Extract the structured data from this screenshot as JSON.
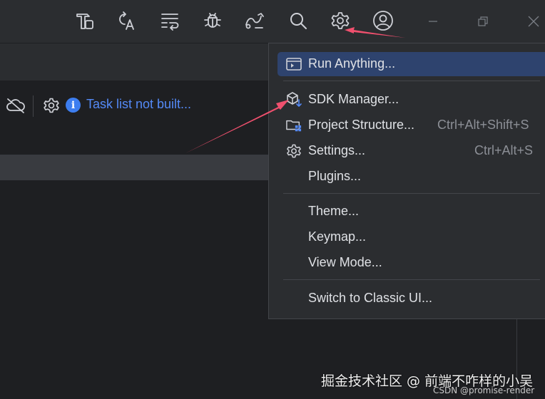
{
  "toolbar": {
    "icons": [
      "build-icon",
      "translate-icon",
      "soft-wrap-icon",
      "bug-icon",
      "route-icon",
      "search-icon",
      "gear-icon",
      "account-icon"
    ],
    "window_controls": [
      "minimize-icon",
      "restore-icon",
      "close-icon"
    ]
  },
  "editor": {
    "task_text": "Task list not built...",
    "link_color": "#548af7"
  },
  "menu": {
    "items": [
      {
        "label": "Run Anything...",
        "shortcut": "",
        "icon": "run-anything-icon",
        "selected": true
      },
      {
        "label": "SDK Manager...",
        "shortcut": "",
        "icon": "sdk-manager-icon",
        "selected": false
      },
      {
        "label": "Project Structure...",
        "shortcut": "Ctrl+Alt+Shift+S",
        "icon": "project-structure-icon",
        "selected": false
      },
      {
        "label": "Settings...",
        "shortcut": "Ctrl+Alt+S",
        "icon": "settings-icon",
        "selected": false
      },
      {
        "label": "Plugins...",
        "shortcut": "",
        "icon": "",
        "selected": false
      },
      {
        "label": "Theme...",
        "shortcut": "",
        "icon": "",
        "selected": false
      },
      {
        "label": "Keymap...",
        "shortcut": "",
        "icon": "",
        "selected": false
      },
      {
        "label": "View Mode...",
        "shortcut": "",
        "icon": "",
        "selected": false
      },
      {
        "label": "Switch to Classic UI...",
        "shortcut": "",
        "icon": "",
        "selected": false
      }
    ],
    "selected_color": "#2e436e"
  },
  "annotation_color": "#f0506e",
  "watermark": {
    "line1": "掘金技术社区 @ 前端不咋样的小吴",
    "line2": "CSDN @promise-render"
  }
}
